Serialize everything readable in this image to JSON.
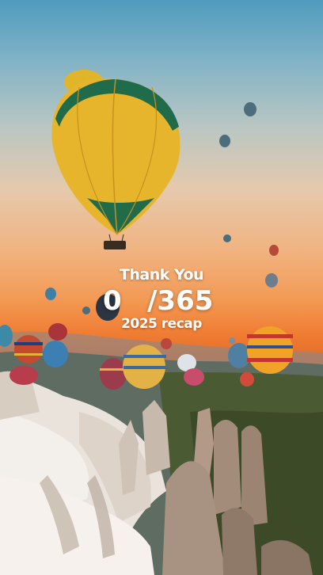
{
  "message": {
    "thanks": "Thank You",
    "current_day": "0",
    "total_days": "/365",
    "subtitle": "2025 recap"
  },
  "background": {
    "description_icon": "hot-air-balloon-landscape",
    "colors": {
      "sky_top": "#4f9bbd",
      "sunset": "#f39a55",
      "horizon": "#e56f2a",
      "rocks": "#d9d2cc"
    }
  }
}
